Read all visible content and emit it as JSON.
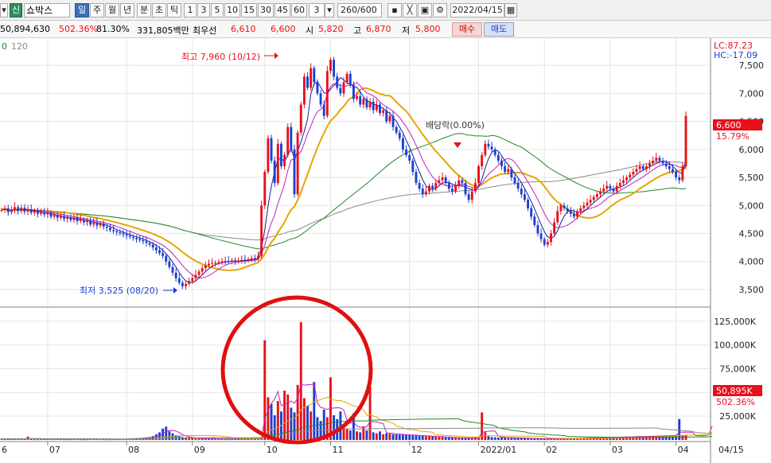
{
  "toolbar": {
    "dropdown_left": "▾",
    "market_badge": "신",
    "stock_name": "쇼박스",
    "periods": [
      "일",
      "주",
      "월",
      "년",
      "분",
      "초",
      "틱"
    ],
    "selected_period": "일",
    "intervals": [
      "1",
      "3",
      "5",
      "10",
      "15",
      "30",
      "45",
      "60"
    ],
    "interval_value": "3",
    "count_value": "260",
    "count_total": "/600",
    "date_value": "2022/04/15"
  },
  "info": {
    "volume": "50,894,630",
    "volume_ratio": "502.36%",
    "turnover": "81.30%",
    "amount": "331,805백만",
    "priority_label": "최우선",
    "ask_price": "6,610",
    "bid_price": "6,600",
    "open_label": "시",
    "open": "5,820",
    "high_label": "고",
    "high": "6,870",
    "low_label": "저",
    "low": "5,800",
    "buy_label": "매수",
    "sell_label": "매도"
  },
  "legend": {
    "ma_first": "0",
    "ma_second": "120"
  },
  "price_axis": {
    "lc": "LC:87.23",
    "hc": "HC:-17.09",
    "ticks": [
      "7,500",
      "7,000",
      "6,500",
      "6,000",
      "5,500",
      "5,000",
      "4,500",
      "4,000",
      "3,500"
    ],
    "current_price": "6,600",
    "current_change": "15.79%"
  },
  "volume_axis": {
    "ticks": [
      "125,000K",
      "100,000K",
      "75,000K",
      "50,000K",
      "25,000K"
    ],
    "current_volume": "50,895K",
    "current_ratio": "502.36%"
  },
  "annotations": {
    "high": "최고 7,960 (10/12)",
    "low": "최저 3,525 (08/20)",
    "dividend": "배당락(0.00%)"
  },
  "x_axis": {
    "labels": [
      "6",
      "07",
      "08",
      "09",
      "10",
      "11",
      "12",
      "2022/01",
      "02",
      "03",
      "04"
    ],
    "end_label": "04/15"
  },
  "colors": {
    "up": "#e8101a",
    "down": "#1b3fd1",
    "ma_short": "#1a1aa6",
    "ma_mid": "#c020c0",
    "ma_orange": "#e8a400",
    "ma_green": "#1f8a2a",
    "ma_gray": "#8a8a8a",
    "circle": "#e01010"
  },
  "chart_data": {
    "type": "candlestick",
    "y_range_price": [
      3300,
      7900
    ],
    "y_range_volume_k": [
      0,
      135000
    ],
    "closes": [
      4920,
      4950,
      4880,
      4910,
      4970,
      4900,
      4960,
      4890,
      4930,
      4870,
      4910,
      4850,
      4880,
      4840,
      4870,
      4800,
      4830,
      4780,
      4810,
      4760,
      4790,
      4740,
      4780,
      4720,
      4750,
      4700,
      4730,
      4660,
      4700,
      4640,
      4680,
      4620,
      4600,
      4560,
      4540,
      4520,
      4500,
      4480,
      4460,
      4440,
      4420,
      4400,
      4380,
      4360,
      4330,
      4300,
      4250,
      4200,
      4150,
      4100,
      4000,
      3900,
      3800,
      3700,
      3620,
      3560,
      3600,
      3650,
      3700,
      3760,
      3820,
      3880,
      3930,
      3960,
      3970,
      3980,
      3990,
      4000,
      4010,
      4000,
      4020,
      4000,
      4010,
      4030,
      4020,
      4040,
      4060,
      4050,
      4100,
      5000,
      5600,
      6200,
      5800,
      5400,
      6100,
      5700,
      5900,
      6400,
      6000,
      5200,
      6300,
      6800,
      7300,
      7100,
      7450,
      7200,
      7000,
      6800,
      6600,
      7400,
      7600,
      7300,
      7100,
      7000,
      7200,
      7350,
      7150,
      6900,
      6950,
      6800,
      6900,
      6750,
      6850,
      6700,
      6800,
      6650,
      6700,
      6500,
      6600,
      6400,
      6300,
      6200,
      6000,
      5900,
      5800,
      5600,
      5400,
      5300,
      5200,
      5250,
      5350,
      5300,
      5400,
      5450,
      5500,
      5400,
      5300,
      5250,
      5350,
      5450,
      5400,
      5200,
      5100,
      5250,
      5400,
      5700,
      5900,
      6100,
      6050,
      6000,
      5900,
      5800,
      5700,
      5600,
      5650,
      5500,
      5400,
      5300,
      5200,
      5100,
      4950,
      4800,
      4650,
      4500,
      4400,
      4300,
      4350,
      4500,
      4700,
      4900,
      5000,
      4950,
      4900,
      4850,
      4800,
      4900,
      4950,
      5000,
      5050,
      5100,
      5150,
      5200,
      5250,
      5300,
      5350,
      5300,
      5250,
      5350,
      5400,
      5450,
      5500,
      5550,
      5600,
      5650,
      5700,
      5650,
      5700,
      5750,
      5800,
      5850,
      5800,
      5750,
      5700,
      5650,
      5600,
      5500,
      5450,
      5700,
      6600
    ],
    "volumes_k": [
      1200,
      900,
      1000,
      1100,
      800,
      950,
      1300,
      1000,
      3500,
      900,
      800,
      700,
      850,
      900,
      1000,
      950,
      800,
      850,
      900,
      700,
      750,
      800,
      850,
      900,
      700,
      650,
      800,
      900,
      1100,
      1000,
      900,
      800,
      750,
      700,
      800,
      850,
      900,
      1000,
      1200,
      1400,
      1600,
      1800,
      2000,
      2200,
      2500,
      3000,
      4000,
      6000,
      8000,
      12000,
      14000,
      9000,
      7000,
      5000,
      4000,
      3000,
      2500,
      2000,
      1800,
      1600,
      1500,
      1400,
      1300,
      1200,
      1100,
      1000,
      950,
      900,
      850,
      800,
      900,
      1000,
      1100,
      1200,
      1300,
      1400,
      1500,
      1600,
      1700,
      2000,
      105000,
      45000,
      38000,
      26000,
      41000,
      30000,
      52000,
      48000,
      34000,
      29000,
      58000,
      124000,
      44000,
      36000,
      30000,
      61000,
      24000,
      20000,
      32000,
      24000,
      66000,
      26000,
      22000,
      30000,
      14000,
      12000,
      10000,
      28000,
      9000,
      8000,
      14000,
      10000,
      56000,
      8000,
      7000,
      9000,
      6000,
      7000,
      6500,
      6000,
      5800,
      5600,
      5400,
      5200,
      5000,
      4800,
      4600,
      4400,
      4200,
      4000,
      3800,
      3600,
      3400,
      3200,
      3000,
      2800,
      2600,
      2400,
      2200,
      2000,
      2000,
      2100,
      2200,
      2300,
      2400,
      2500,
      29000,
      8000,
      4000,
      3000,
      2800,
      2600,
      2500,
      2400,
      2300,
      2200,
      2100,
      2000,
      1900,
      1800,
      1700,
      1600,
      1500,
      1400,
      1300,
      1200,
      1100,
      1000,
      1100,
      1200,
      1300,
      1400,
      1500,
      1600,
      1700,
      1800,
      1900,
      2000,
      2100,
      2200,
      2300,
      2400,
      2500,
      2600,
      2700,
      2800,
      2900,
      3000,
      3100,
      3200,
      3300,
      3400,
      3500,
      3600,
      3700,
      3800,
      3900,
      4000,
      4100,
      4200,
      4300,
      4400,
      4500,
      4600,
      4700,
      4800,
      22000,
      5000,
      4800,
      4600,
      4400,
      4200,
      4000,
      5000,
      6000,
      8000,
      50895
    ],
    "x_ticks": [
      "6",
      "07",
      "08",
      "09",
      "10",
      "11",
      "12",
      "2022/01",
      "02",
      "03",
      "04"
    ],
    "price_ticks": [
      7500,
      7000,
      6500,
      6000,
      5500,
      5000,
      4500,
      4000,
      3500
    ],
    "volume_ticks_k": [
      125000,
      100000,
      75000,
      50000,
      25000
    ]
  }
}
